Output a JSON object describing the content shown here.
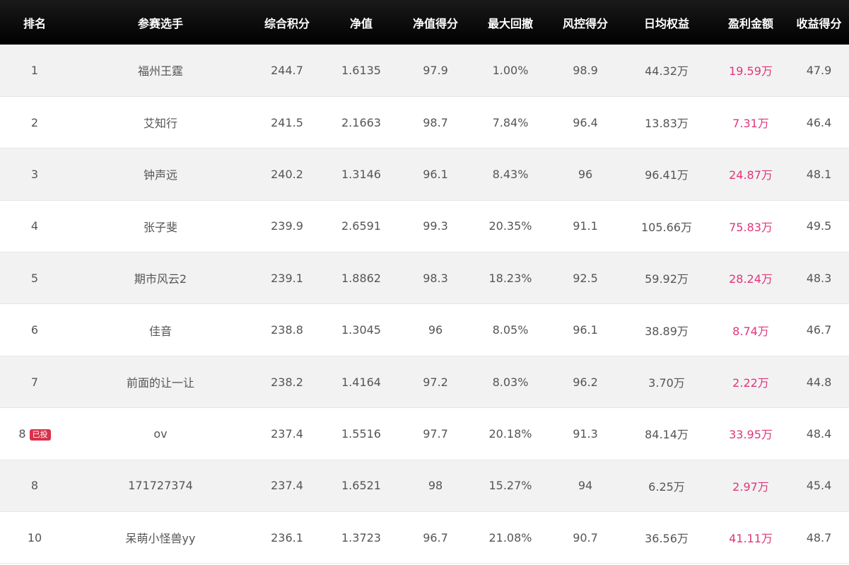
{
  "table": {
    "headers": [
      "排名",
      "参赛选手",
      "综合积分",
      "净值",
      "净值得分",
      "最大回撤",
      "风控得分",
      "日均权益",
      "盈利金额",
      "收益得分"
    ],
    "rows": [
      {
        "rank": "1",
        "badge": "",
        "player": "福州王霆",
        "score": "244.7",
        "nav": "1.6135",
        "nav_score": "97.9",
        "max_drawdown": "1.00%",
        "risk_score": "98.9",
        "avg_equity": "44.32万",
        "profit": "19.59万",
        "return_score": "47.9"
      },
      {
        "rank": "2",
        "badge": "",
        "player": "艾知行",
        "score": "241.5",
        "nav": "2.1663",
        "nav_score": "98.7",
        "max_drawdown": "7.84%",
        "risk_score": "96.4",
        "avg_equity": "13.83万",
        "profit": "7.31万",
        "return_score": "46.4"
      },
      {
        "rank": "3",
        "badge": "",
        "player": "钟声远",
        "score": "240.2",
        "nav": "1.3146",
        "nav_score": "96.1",
        "max_drawdown": "8.43%",
        "risk_score": "96",
        "avg_equity": "96.41万",
        "profit": "24.87万",
        "return_score": "48.1"
      },
      {
        "rank": "4",
        "badge": "",
        "player": "张子斐",
        "score": "239.9",
        "nav": "2.6591",
        "nav_score": "99.3",
        "max_drawdown": "20.35%",
        "risk_score": "91.1",
        "avg_equity": "105.66万",
        "profit": "75.83万",
        "return_score": "49.5"
      },
      {
        "rank": "5",
        "badge": "",
        "player": "期市风云2",
        "score": "239.1",
        "nav": "1.8862",
        "nav_score": "98.3",
        "max_drawdown": "18.23%",
        "risk_score": "92.5",
        "avg_equity": "59.92万",
        "profit": "28.24万",
        "return_score": "48.3"
      },
      {
        "rank": "6",
        "badge": "",
        "player": "佳音",
        "score": "238.8",
        "nav": "1.3045",
        "nav_score": "96",
        "max_drawdown": "8.05%",
        "risk_score": "96.1",
        "avg_equity": "38.89万",
        "profit": "8.74万",
        "return_score": "46.7"
      },
      {
        "rank": "7",
        "badge": "",
        "player": "前面的让一让",
        "score": "238.2",
        "nav": "1.4164",
        "nav_score": "97.2",
        "max_drawdown": "8.03%",
        "risk_score": "96.2",
        "avg_equity": "3.70万",
        "profit": "2.22万",
        "return_score": "44.8"
      },
      {
        "rank": "8",
        "badge": "已投",
        "player": "ov",
        "score": "237.4",
        "nav": "1.5516",
        "nav_score": "97.7",
        "max_drawdown": "20.18%",
        "risk_score": "91.3",
        "avg_equity": "84.14万",
        "profit": "33.95万",
        "return_score": "48.4"
      },
      {
        "rank": "8",
        "badge": "",
        "player": "171727374",
        "score": "237.4",
        "nav": "1.6521",
        "nav_score": "98",
        "max_drawdown": "15.27%",
        "risk_score": "94",
        "avg_equity": "6.25万",
        "profit": "2.97万",
        "return_score": "45.4"
      },
      {
        "rank": "10",
        "badge": "",
        "player": "呆萌小怪兽yy",
        "score": "236.1",
        "nav": "1.3723",
        "nav_score": "96.7",
        "max_drawdown": "21.08%",
        "risk_score": "90.7",
        "avg_equity": "36.56万",
        "profit": "41.11万",
        "return_score": "48.7"
      }
    ]
  },
  "colors": {
    "header_bg": "#0d0d0d",
    "header_text": "#ffffff",
    "row_alt_bg": "#f2f2f2",
    "body_text": "#555555",
    "profit_text": "#e0357a",
    "badge_bg": "#d9304a"
  }
}
